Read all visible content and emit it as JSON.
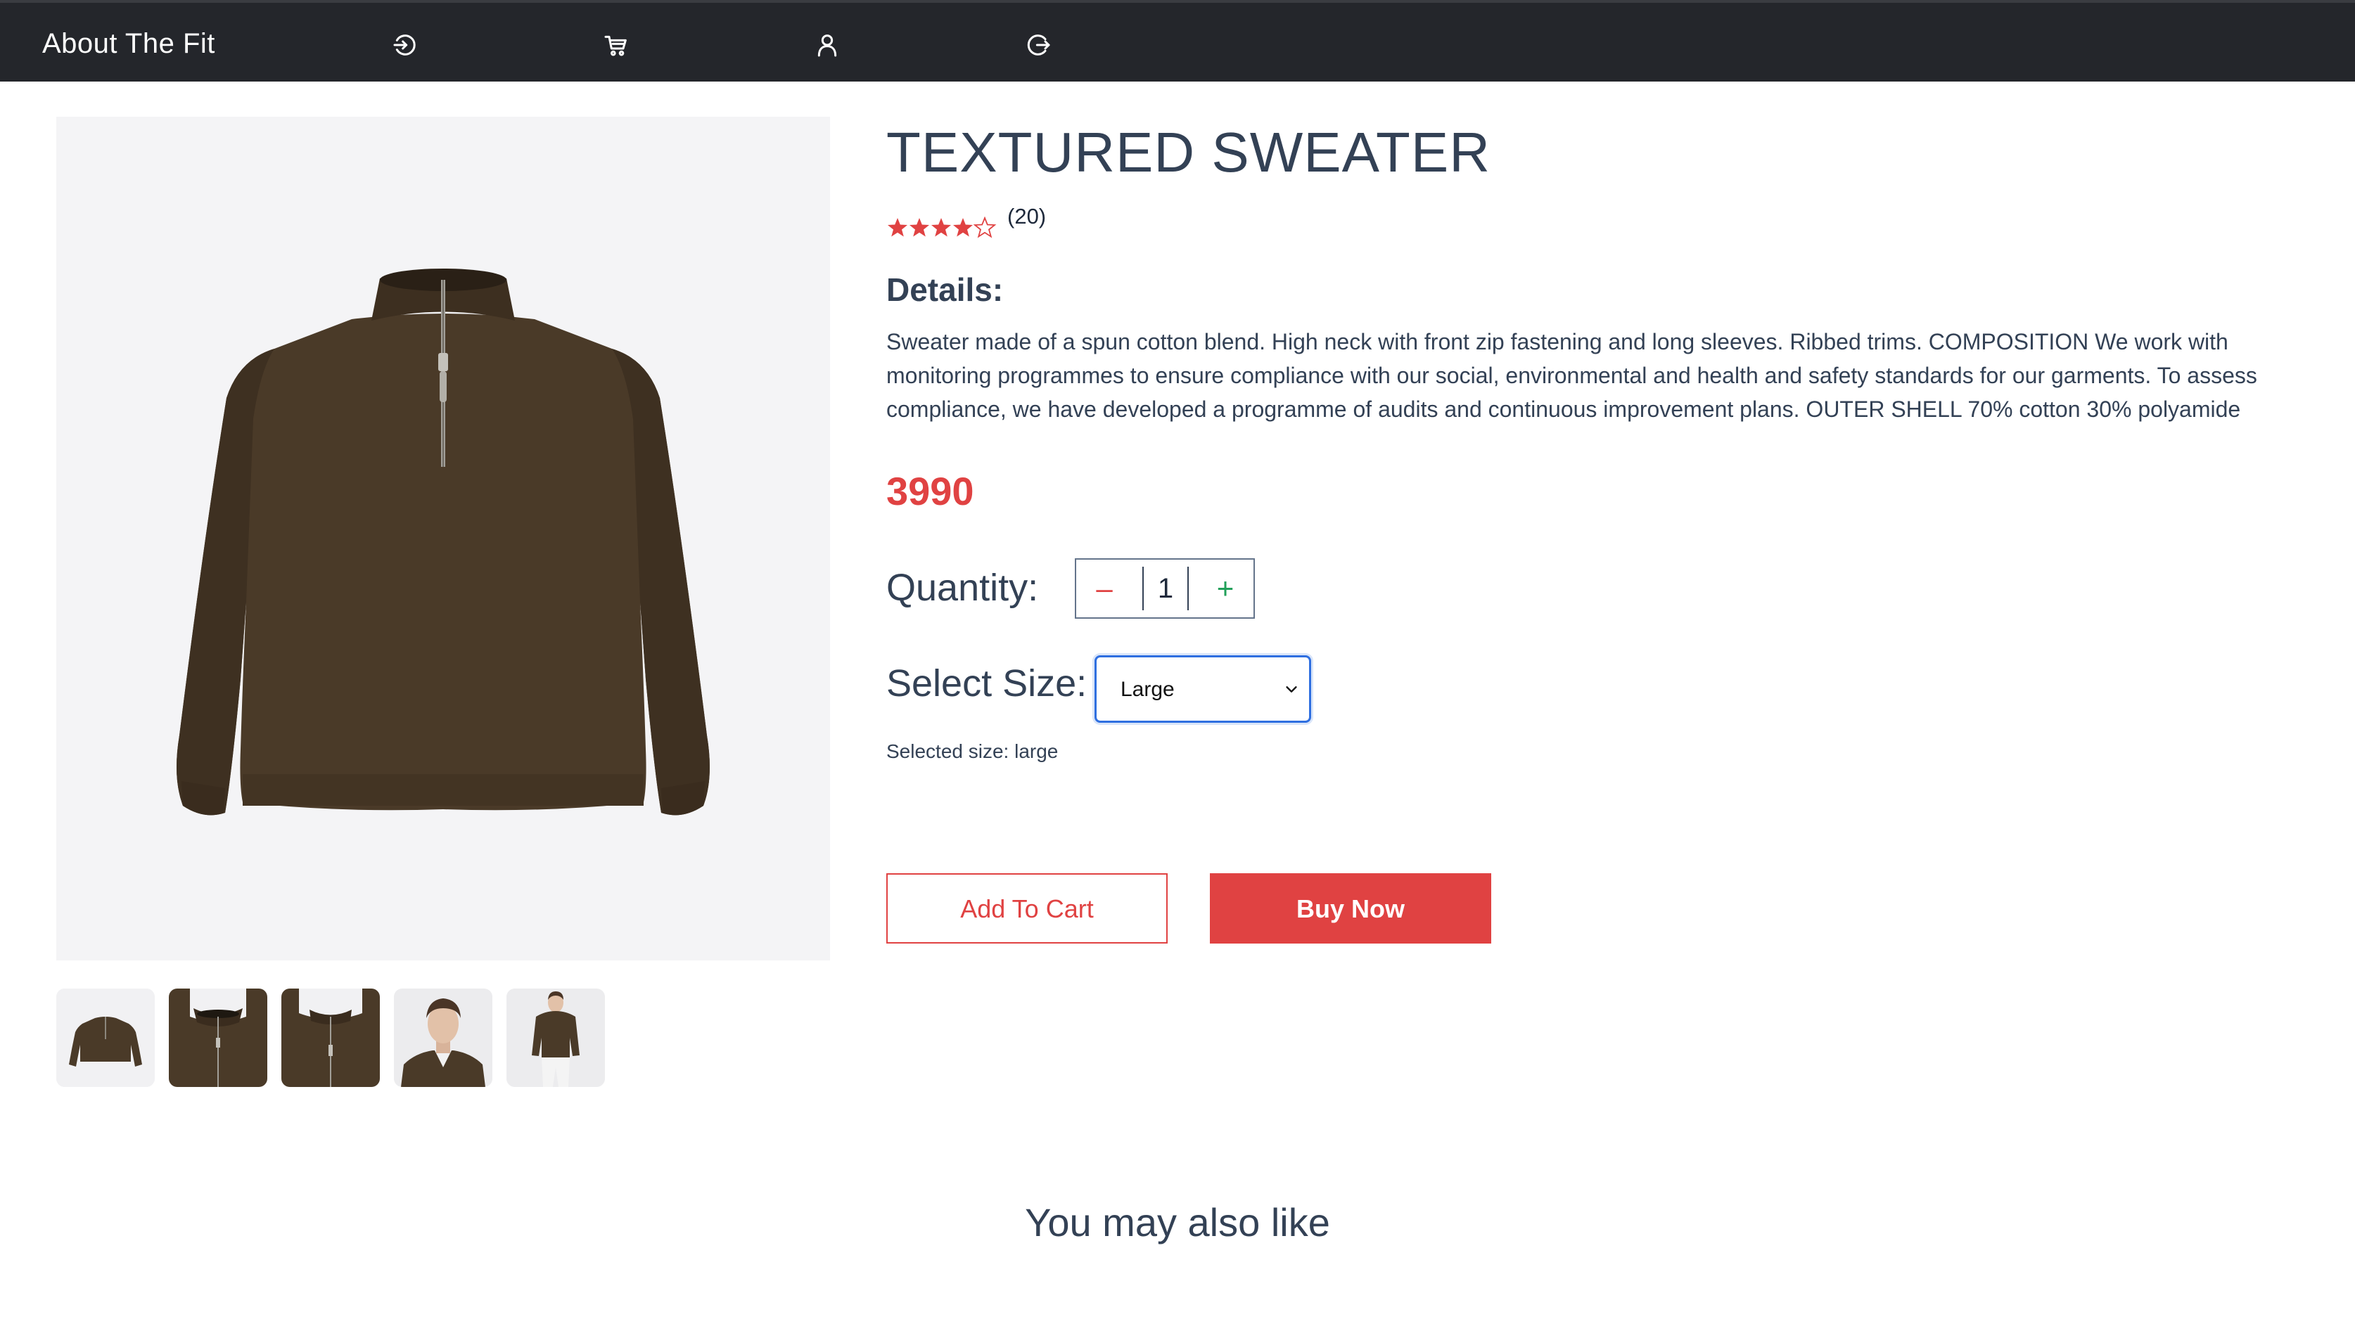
{
  "navbar": {
    "brand": "About The Fit",
    "icons": [
      "login-icon",
      "cart-icon",
      "user-icon",
      "logout-icon"
    ]
  },
  "product": {
    "title": "TEXTURED SWEATER",
    "rating": {
      "stars": 4,
      "max_stars": 5,
      "count_label": "(20)"
    },
    "details_heading": "Details:",
    "description": "Sweater made of a spun cotton blend. High neck with front zip fastening and long sleeves. Ribbed trims. COMPOSITION We work with monitoring programmes to ensure compliance with our social, environmental and health and safety standards for our garments. To assess compliance, we have developed a programme of audits and continuous improvement plans. OUTER SHELL 70% cotton 30% polyamide",
    "price": "3990",
    "quantity": {
      "label": "Quantity:",
      "minus": "–",
      "value": "1",
      "plus": "+"
    },
    "size": {
      "label": "Select Size:",
      "selected": "Large",
      "selected_text": "Selected size: large"
    },
    "buttons": {
      "add_to_cart": "Add To Cart",
      "buy_now": "Buy Now"
    },
    "thumbnails": [
      "sweater-flat",
      "sweater-collar-detail",
      "sweater-zip-detail",
      "model-portrait",
      "model-full"
    ]
  },
  "related": {
    "heading": "You may also like"
  },
  "colors": {
    "navbar_bg": "#24262b",
    "accent_red": "#e04242",
    "text_slate": "#334155",
    "sweater_brown": "#4a3a28",
    "plus_green": "#22a05a",
    "focus_blue": "#2f6fe0"
  }
}
